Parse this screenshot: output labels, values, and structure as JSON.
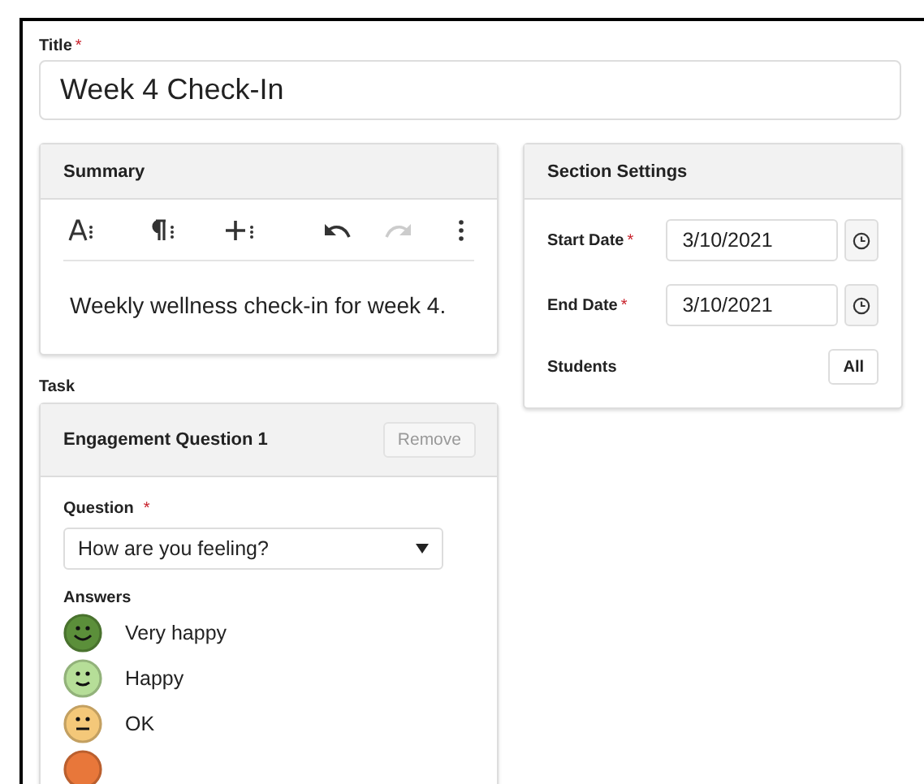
{
  "title_field": {
    "label": "Title",
    "required_mark": "*",
    "value": "Week 4 Check-In"
  },
  "summary": {
    "heading": "Summary",
    "toolbar": [
      {
        "kind": "font",
        "disabled": false
      },
      {
        "kind": "paragraph",
        "disabled": false
      },
      {
        "kind": "insert",
        "disabled": false
      },
      {
        "kind": "undo",
        "disabled": false
      },
      {
        "kind": "redo",
        "disabled": true
      },
      {
        "kind": "more",
        "disabled": false
      }
    ],
    "text": "Weekly wellness check-in for week 4."
  },
  "section_settings": {
    "heading": "Section Settings",
    "dates": [
      {
        "label": "Start Date",
        "required_mark": "*",
        "value": "3/10/2021"
      },
      {
        "label": "End Date",
        "required_mark": "*",
        "value": "3/10/2021"
      }
    ],
    "students": {
      "label": "Students",
      "button": "All"
    }
  },
  "task": {
    "label": "Task",
    "card": {
      "heading": "Engagement Question 1",
      "remove_button": "Remove",
      "question": {
        "label": "Question",
        "required_mark": "*",
        "value": "How are you feeling?"
      },
      "answers_label": "Answers",
      "answers": [
        {
          "label": "Very happy",
          "kind": "big-smile",
          "color": "#5b8f3a"
        },
        {
          "label": "Happy",
          "kind": "smile",
          "color": "#b6de98"
        },
        {
          "label": "OK",
          "kind": "neutral",
          "color": "#f4c879"
        },
        {
          "kind": "hidden",
          "color": "#e8773a"
        }
      ]
    }
  }
}
